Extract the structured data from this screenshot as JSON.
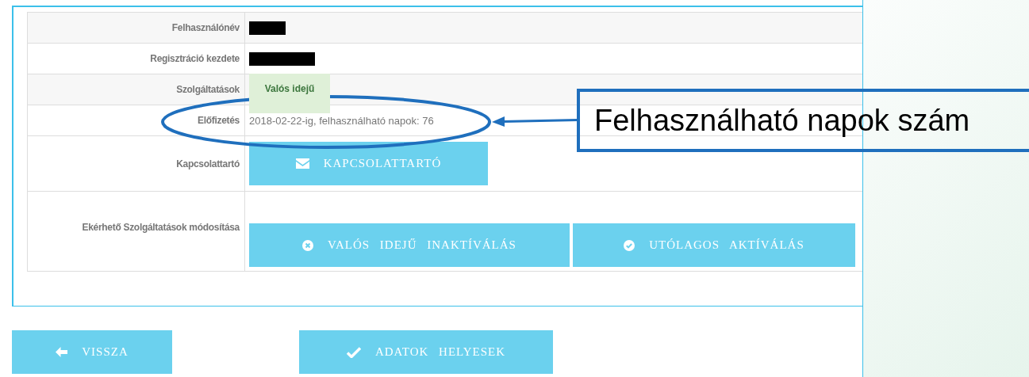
{
  "details": {
    "rows": [
      {
        "label": "Felhasználónév",
        "kind": "redacted"
      },
      {
        "label": "Regisztráció kezdete",
        "kind": "redacted"
      },
      {
        "label": "Szolgáltatások",
        "kind": "badge",
        "value": "Valós idejű"
      },
      {
        "label": "Előfizetés",
        "kind": "text",
        "value": "2018-02-22-ig, felhasználható napok: 76"
      },
      {
        "label": "Kapcsolattartó",
        "kind": "buttons",
        "buttons": [
          {
            "label": "KAPCSOLATTARTÓ"
          }
        ]
      },
      {
        "label": "Ekérhető Szolgáltatások módosítása",
        "kind": "buttons",
        "buttons": [
          {
            "label": "VALÓS IDEJŰ INAKTÍVÁLÁS"
          },
          {
            "label": "UTÓLAGOS AKTÍVÁLÁS"
          }
        ]
      }
    ]
  },
  "footer_buttons": [
    {
      "label": "VISSZA"
    },
    {
      "label": "ADATOK HELYESEK"
    }
  ],
  "callout": {
    "text": "Felhasználható napok szám"
  }
}
